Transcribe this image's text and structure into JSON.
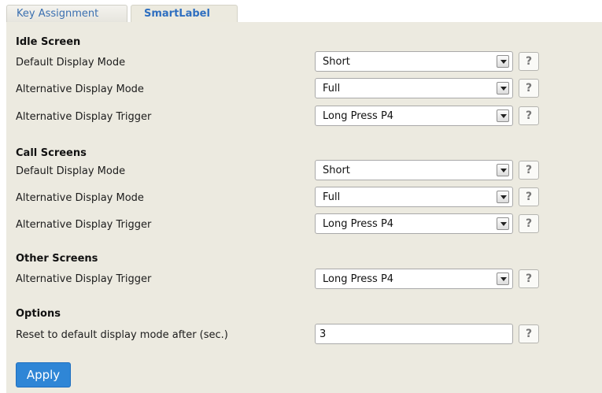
{
  "tabs": {
    "key_assignment": "Key Assignment",
    "smartlabel": "SmartLabel"
  },
  "sections": {
    "idle": {
      "heading": "Idle Screen",
      "default_mode_label": "Default Display Mode",
      "default_mode_value": "Short",
      "alt_mode_label": "Alternative Display Mode",
      "alt_mode_value": "Full",
      "alt_trigger_label": "Alternative Display Trigger",
      "alt_trigger_value": "Long Press P4"
    },
    "call": {
      "heading": "Call Screens",
      "default_mode_label": "Default Display Mode",
      "default_mode_value": "Short",
      "alt_mode_label": "Alternative Display Mode",
      "alt_mode_value": "Full",
      "alt_trigger_label": "Alternative Display Trigger",
      "alt_trigger_value": "Long Press P4"
    },
    "other": {
      "heading": "Other Screens",
      "alt_trigger_label": "Alternative Display Trigger",
      "alt_trigger_value": "Long Press P4"
    },
    "options": {
      "heading": "Options",
      "reset_label": "Reset to default display mode after (sec.)",
      "reset_value": "3"
    }
  },
  "help_symbol": "?",
  "apply_label": "Apply",
  "colors": {
    "panel_bg": "#eceae0",
    "active_tab_text": "#2f6fc0",
    "apply_button": "#2f86d6"
  }
}
